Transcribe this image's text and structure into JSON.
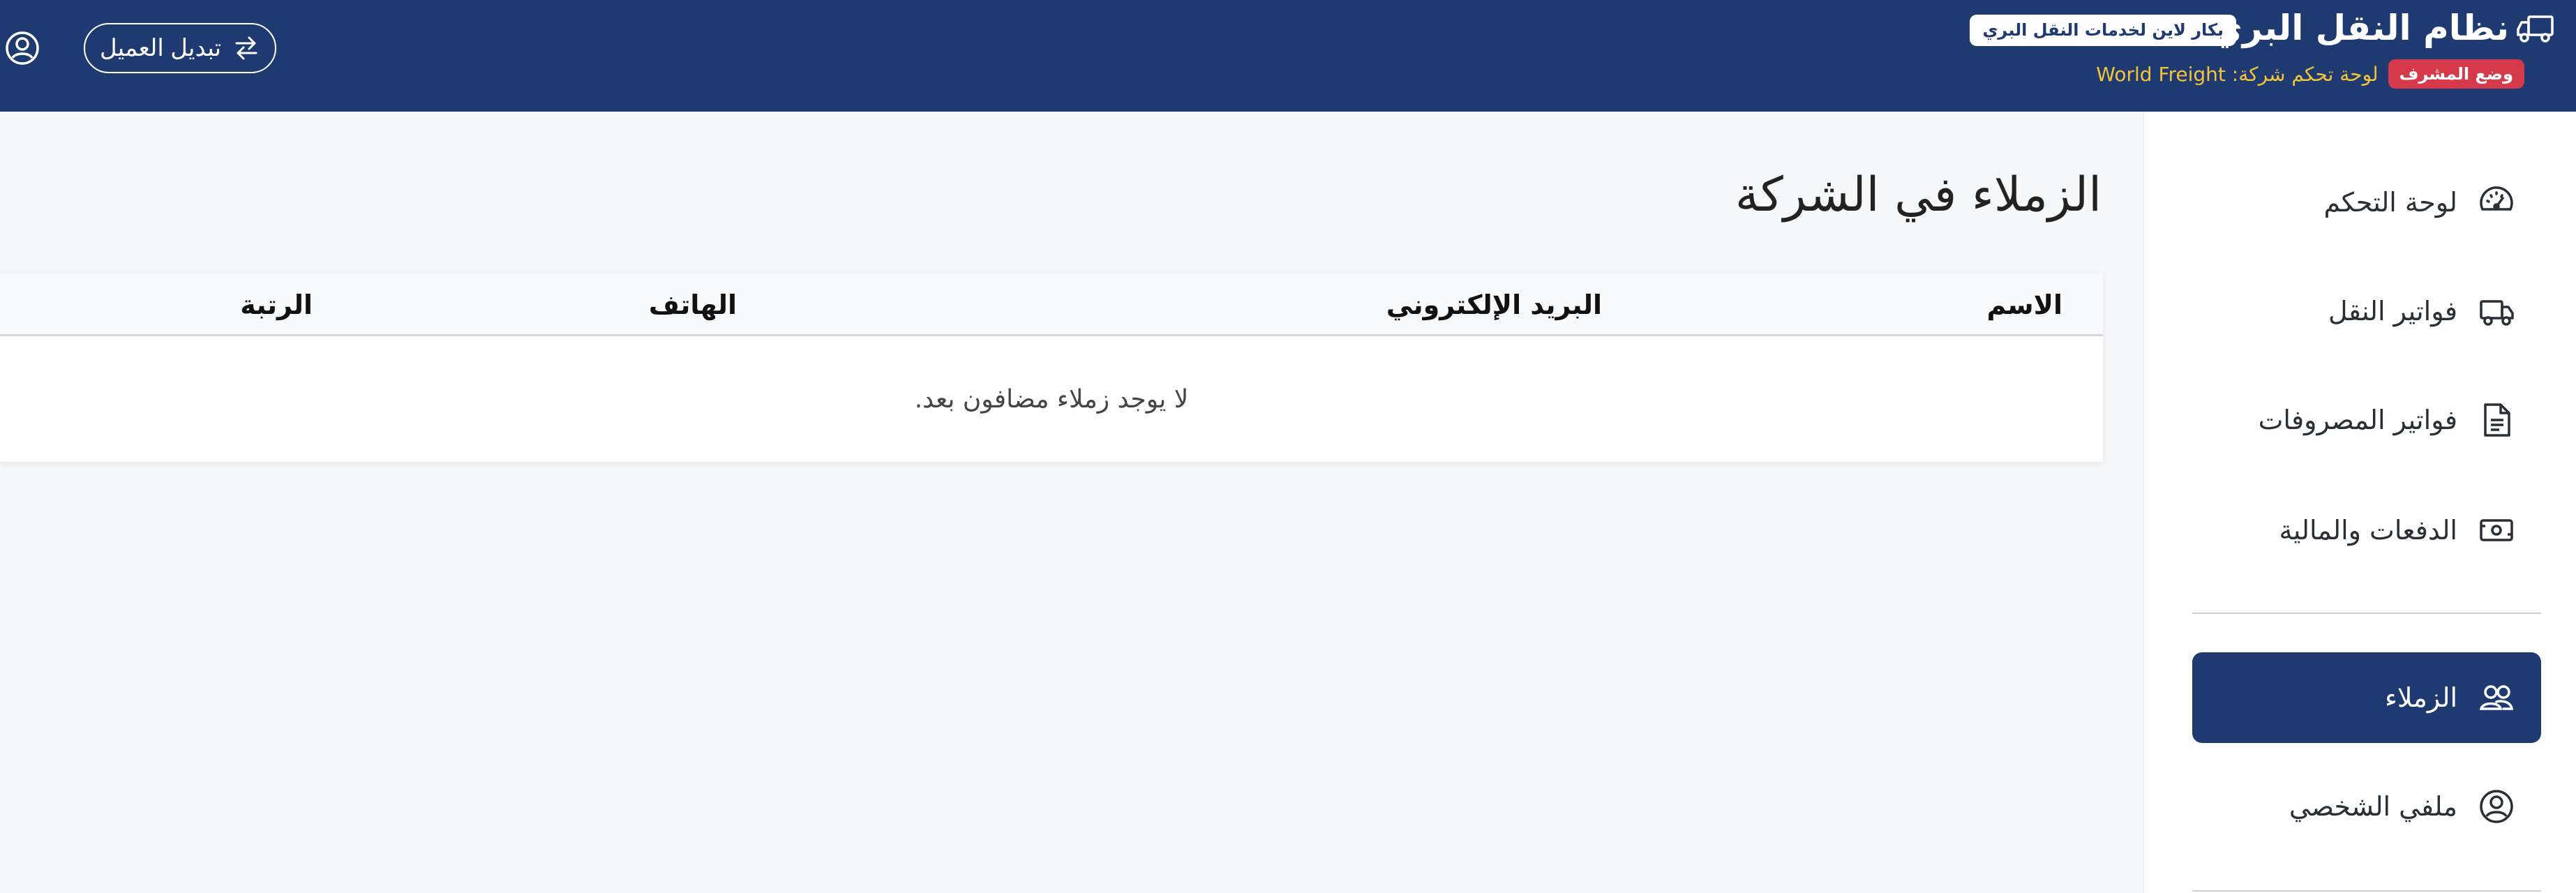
{
  "header": {
    "app_title": "نظام النقل البري",
    "company_pill": "بكار لاين لخدمات النقل البري",
    "admin_badge": "وضع المشرف",
    "dashboard_text": "لوحة تحكم شركة: World Freight",
    "switch_client_label": "تبديل العميل",
    "icons": {
      "brand": "truck-icon",
      "switch": "swap-arrows-icon",
      "user": "user-circle-icon"
    }
  },
  "sidebar": {
    "items": [
      {
        "label": "لوحة التحكم",
        "icon": "speedometer-icon",
        "active": false
      },
      {
        "label": "فواتير النقل",
        "icon": "truck-icon",
        "active": false
      },
      {
        "label": "فواتير المصروفات",
        "icon": "document-icon",
        "active": false
      },
      {
        "label": "الدفعات والمالية",
        "icon": "cash-icon",
        "active": false
      },
      {
        "label": "الزملاء",
        "icon": "people-icon",
        "active": true
      },
      {
        "label": "ملفي الشخصي",
        "icon": "user-circle-icon",
        "active": false
      }
    ]
  },
  "main": {
    "title": "الزملاء في الشركة",
    "table": {
      "columns": [
        "الاسم",
        "البريد الإلكتروني",
        "الهاتف",
        "الرتبة"
      ],
      "rows": [],
      "empty_message": "لا يوجد زملاء مضافون بعد."
    }
  },
  "colors": {
    "primary": "#1f3a70",
    "admin_badge": "#d63a4a",
    "highlight_text": "#f2c43c",
    "background": "#f6f7f9"
  }
}
